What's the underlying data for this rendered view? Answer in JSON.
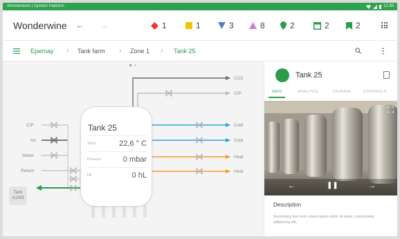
{
  "statusbar": {
    "title": "Wonderware | System Platform",
    "time": "12:30"
  },
  "appbar": {
    "title": "Wonderwine",
    "counters": [
      {
        "icon": "diamond-icon",
        "color": "#e53935",
        "value": "1"
      },
      {
        "icon": "square-icon",
        "color": "#f2c500",
        "value": "1"
      },
      {
        "icon": "triangle-down-icon",
        "color": "#4a7fc1",
        "value": "3"
      },
      {
        "icon": "triangle-up-icon",
        "color": "#c97fcf",
        "value": "8"
      },
      {
        "icon": "map-pin-icon",
        "color": "#2a9d4b",
        "value": "2"
      },
      {
        "icon": "calendar-icon",
        "color": "#2a9d4b",
        "value": "2"
      },
      {
        "icon": "bookmark-icon",
        "color": "#2a9d4b",
        "value": "2"
      }
    ]
  },
  "breadcrumb": [
    "Epernay",
    "Tank farm",
    "Zone 1",
    "Tank 25"
  ],
  "diagram": {
    "right_lines": [
      "CO2",
      "CIP",
      "Cold",
      "Cold",
      "Heat",
      "Heat"
    ],
    "left_lines": [
      "CIP",
      "Air",
      "Water",
      "Return"
    ],
    "tank": {
      "name": "Tank 25",
      "rows": [
        {
          "label": "Temp",
          "value": "22,6 ° C"
        },
        {
          "label": "Pressure",
          "value": "0 mbar"
        },
        {
          "label": "Fill",
          "value": "0 hL"
        }
      ]
    },
    "tank_tag": [
      "Tank",
      "A1005"
    ]
  },
  "panel": {
    "title": "Tank 25",
    "status_color": "#2a9d4b",
    "tabs": [
      "INFO",
      "ANALYSIS",
      "JOURNAL",
      "CONTROLS"
    ],
    "description_title": "Description",
    "description_text": "Secondary line text Lorem ipsum dolor sit amet, consectetur adipiscing elit."
  }
}
